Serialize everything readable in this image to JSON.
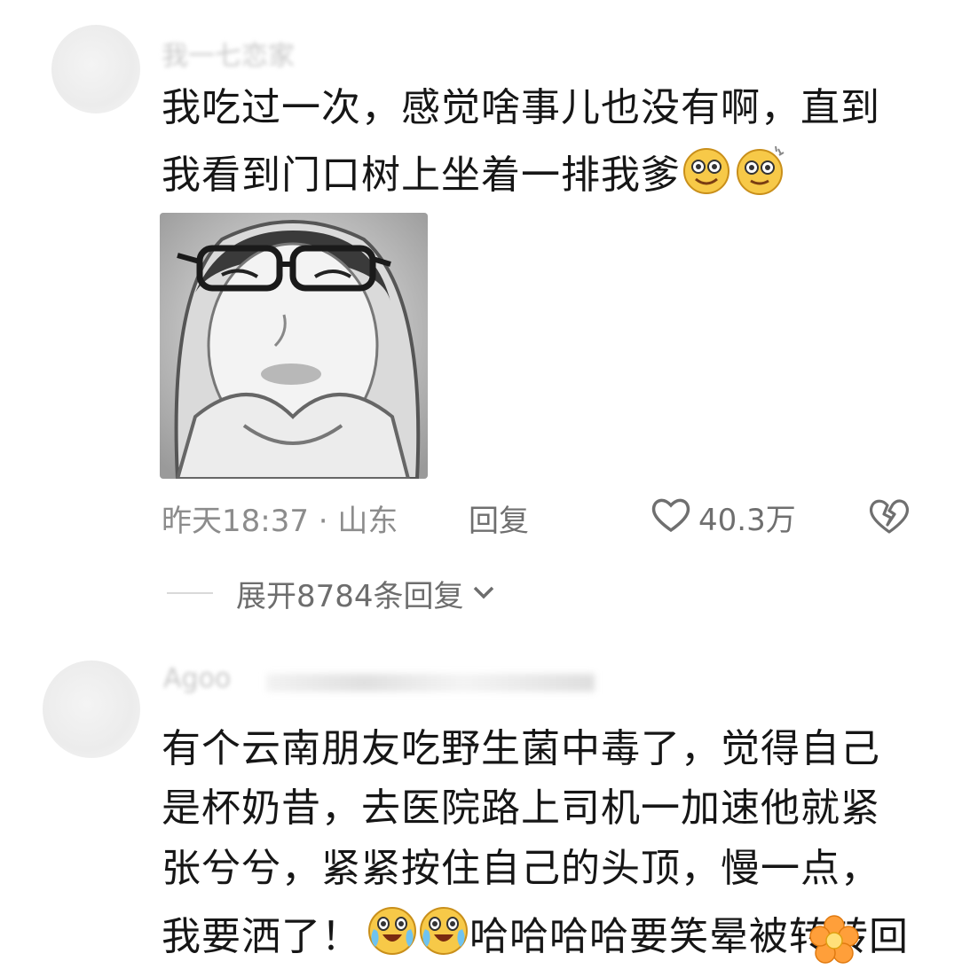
{
  "comment1": {
    "username": "我一七恋家",
    "text_line1": "我吃过一次，感觉啥事儿也没有啊，直到",
    "text_line2": "我看到门口树上坐着一排我爹",
    "meta_time_location": "昨天18:37 · 山东",
    "reply_label": "回复",
    "like_count": "40.3万",
    "expand_replies": "展开8784条回复"
  },
  "comment2": {
    "username": "Agoo",
    "text_line1": "有个云南朋友吃野生菌中毒了，觉得自己",
    "text_line2": "是杯奶昔，去医院路上司机一加速他就紧",
    "text_line3": "张兮兮，紧紧按住自己的头顶，慢一点，",
    "text_line4_a": "我要洒了！",
    "text_line4_b": "哈哈哈哈要笑晕被转",
    "text_line4_c": "转回"
  },
  "icons": {
    "emoji_dizzy": "dizzy-face-emoji",
    "emoji_crying_laugh": "loudly-crying-emoji",
    "heart": "heart-icon",
    "dislike": "broken-heart-icon",
    "chevron": "chevron-down-icon",
    "flower": "flower-sticker-icon"
  }
}
